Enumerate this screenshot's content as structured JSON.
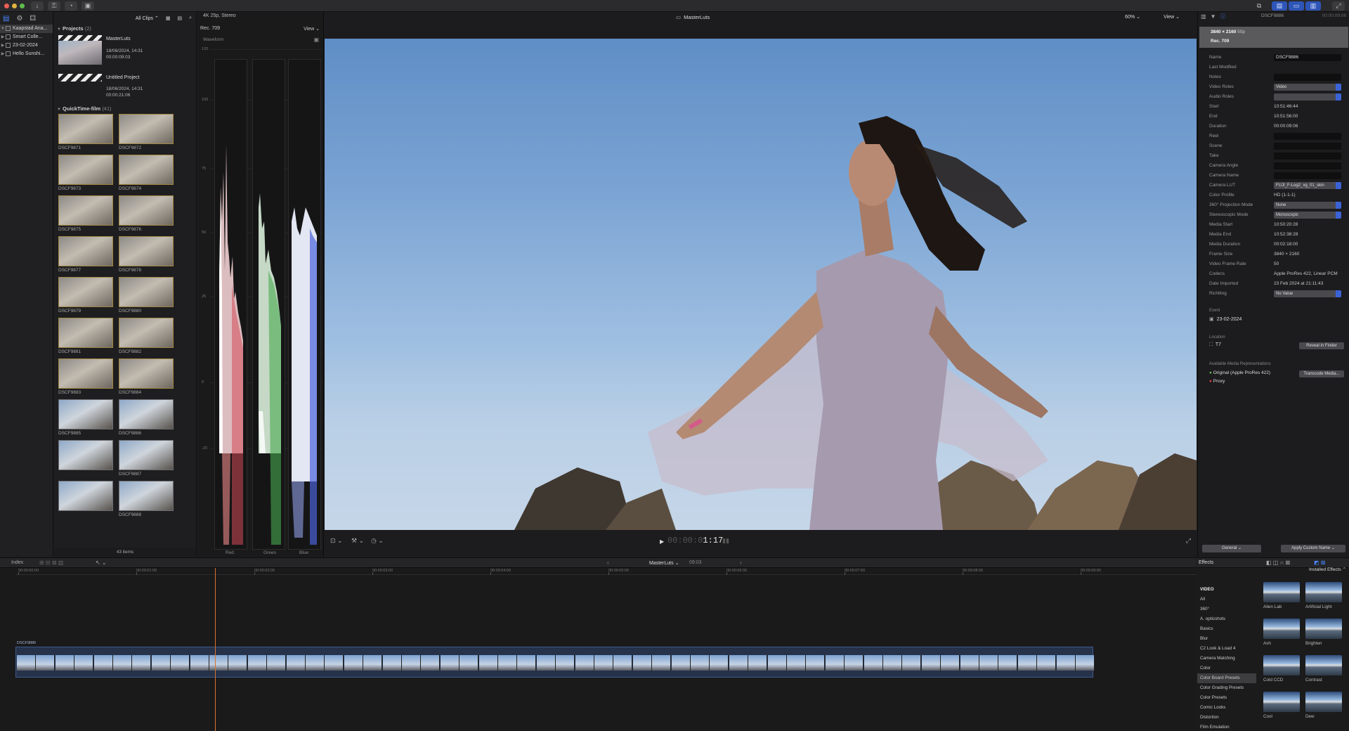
{
  "titlebar": {
    "all_clips": "All Clips",
    "center_title": "MasterLuts",
    "zoom": "60%",
    "view": "View"
  },
  "library": {
    "items": [
      {
        "label": "Kaapstad Ana...",
        "selected": true
      },
      {
        "label": "Smart Colle..."
      },
      {
        "label": "23-02-2024"
      },
      {
        "label": "Hello Sunshi..."
      }
    ]
  },
  "browser": {
    "projects_title": "Projects",
    "projects_count": "(2)",
    "projects": [
      {
        "name": "MasterLuts",
        "date": "18/06/2024, 14:31",
        "duration": "00:00:09:03"
      },
      {
        "name": "Untitled Project",
        "date": "18/06/2024, 14:31",
        "duration": "00:00:21:06"
      }
    ],
    "event_title": "QuickTime-film",
    "event_count": "(41)",
    "clips": [
      "DSCF9871",
      "DSCF9872",
      "DSCF9873",
      "DSCF9874",
      "DSCF9875",
      "DSCF9876",
      "DSCF9877",
      "DSCF9878",
      "DSCF9879",
      "DSCF9880",
      "DSCF9881",
      "DSCF9882",
      "DSCF9883",
      "DSCF9884",
      "DSCF9885",
      "DSCF9886",
      "",
      "DSCF9887",
      "",
      "DSCF9888"
    ],
    "items_count": "43 items"
  },
  "scopes": {
    "format": "4K 25p, Stereo",
    "colorspace": "Rec. 709",
    "view": "View",
    "type": "Waveform",
    "ticks": [
      "120",
      "100",
      "75",
      "50",
      "25",
      "0",
      "-20"
    ],
    "channels": [
      "Red",
      "Green",
      "Blue"
    ]
  },
  "viewer": {
    "timecode_dim": "00:00:0",
    "timecode_bright": "1:17"
  },
  "inspector": {
    "header_size": "3840 × 2160",
    "header_fps": "50p",
    "header_title": "DSCF9886",
    "header_time": "00:00:09:06",
    "header_colorspace": "Rec. 709",
    "rows": [
      {
        "label": "Name",
        "value": "DSCF9886",
        "kind": "field"
      },
      {
        "label": "Last Modified",
        "value": "",
        "kind": "text"
      },
      {
        "label": "Notes",
        "value": "",
        "kind": "field"
      },
      {
        "label": "Video Roles",
        "value": "Video",
        "kind": "select"
      },
      {
        "label": "Audio Roles",
        "value": "",
        "kind": "select"
      },
      {
        "label": "Start",
        "value": "10:51:46:44",
        "kind": "text"
      },
      {
        "label": "End",
        "value": "10:51:56:00",
        "kind": "text"
      },
      {
        "label": "Duration",
        "value": "00:00:09:06",
        "kind": "text"
      },
      {
        "label": "Reel",
        "value": "",
        "kind": "field"
      },
      {
        "label": "Scene",
        "value": "",
        "kind": "field"
      },
      {
        "label": "Take",
        "value": "",
        "kind": "field"
      },
      {
        "label": "Camera Angle",
        "value": "",
        "kind": "field"
      },
      {
        "label": "Camera Name",
        "value": "",
        "kind": "field"
      },
      {
        "label": "Camera LUT",
        "value": "FUJI_F-Log2_vg_01_skin",
        "kind": "select"
      },
      {
        "label": "Color Profile",
        "value": "HD (1-1-1)",
        "kind": "text"
      },
      {
        "label": "360° Projection Mode",
        "value": "None",
        "kind": "select"
      },
      {
        "label": "Stereoscopic Mode",
        "value": "Monoscopic",
        "kind": "select"
      },
      {
        "label": "Media Start",
        "value": "10:50:20:28",
        "kind": "text"
      },
      {
        "label": "Media End",
        "value": "10:52:38:28",
        "kind": "text"
      },
      {
        "label": "Media Duration",
        "value": "00:02:18:00",
        "kind": "text"
      },
      {
        "label": "Frame Size",
        "value": "3840 × 2160",
        "kind": "text"
      },
      {
        "label": "Video Frame Rate",
        "value": "50",
        "kind": "text"
      },
      {
        "label": "Codecs",
        "value": "Apple ProRes 422, Linear PCM",
        "kind": "text"
      },
      {
        "label": "Date Imported",
        "value": "23 Feb 2024 at 21:11:43",
        "kind": "text"
      },
      {
        "label": "Richtling",
        "value": "No Value",
        "kind": "select"
      }
    ],
    "event_label": "Event",
    "event_value": "23-02-2024",
    "location_label": "Location",
    "location_value": "T7",
    "reveal_button": "Reveal in Finder",
    "media_reps_label": "Available Media Representations",
    "original_rep": "Original (Apple ProRes 422)",
    "proxy_rep": "Proxy",
    "transcode_button": "Transcode Media...",
    "general_button": "General",
    "apply_button": "Apply Custom Name"
  },
  "timeline": {
    "index": "Index",
    "project": "MasterLuts",
    "duration": "09:03",
    "clip_name": "DSCF9886",
    "ruler": [
      "00:00:00:00",
      "00:00:01:00",
      "00:00:02:00",
      "00:00:03:00",
      "00:00:04:00",
      "00:00:05:00",
      "00:00:06:00",
      "00:00:07:00",
      "00:00:08:00",
      "00:00:09:00"
    ]
  },
  "effects": {
    "title": "Effects",
    "installed": "Installed Effects",
    "categories": [
      {
        "label": "VIDEO",
        "header": true
      },
      {
        "label": "All"
      },
      {
        "label": "360°"
      },
      {
        "label": "A. opticshots"
      },
      {
        "label": "Basics"
      },
      {
        "label": "Blur"
      },
      {
        "label": "C2 Look & Load 4"
      },
      {
        "label": "Camera Matching"
      },
      {
        "label": "Color"
      },
      {
        "label": "Color Board Presets",
        "selected": true
      },
      {
        "label": "Color Grading Presets"
      },
      {
        "label": "Color Presets"
      },
      {
        "label": "Comic Looks"
      },
      {
        "label": "Distortion"
      },
      {
        "label": "Film Emulation"
      }
    ],
    "thumbs": [
      "Alien Lab",
      "Artificial Light",
      "Ash",
      "Brighten",
      "Cold CCD",
      "Contrast",
      "Cool",
      "Dew"
    ]
  }
}
